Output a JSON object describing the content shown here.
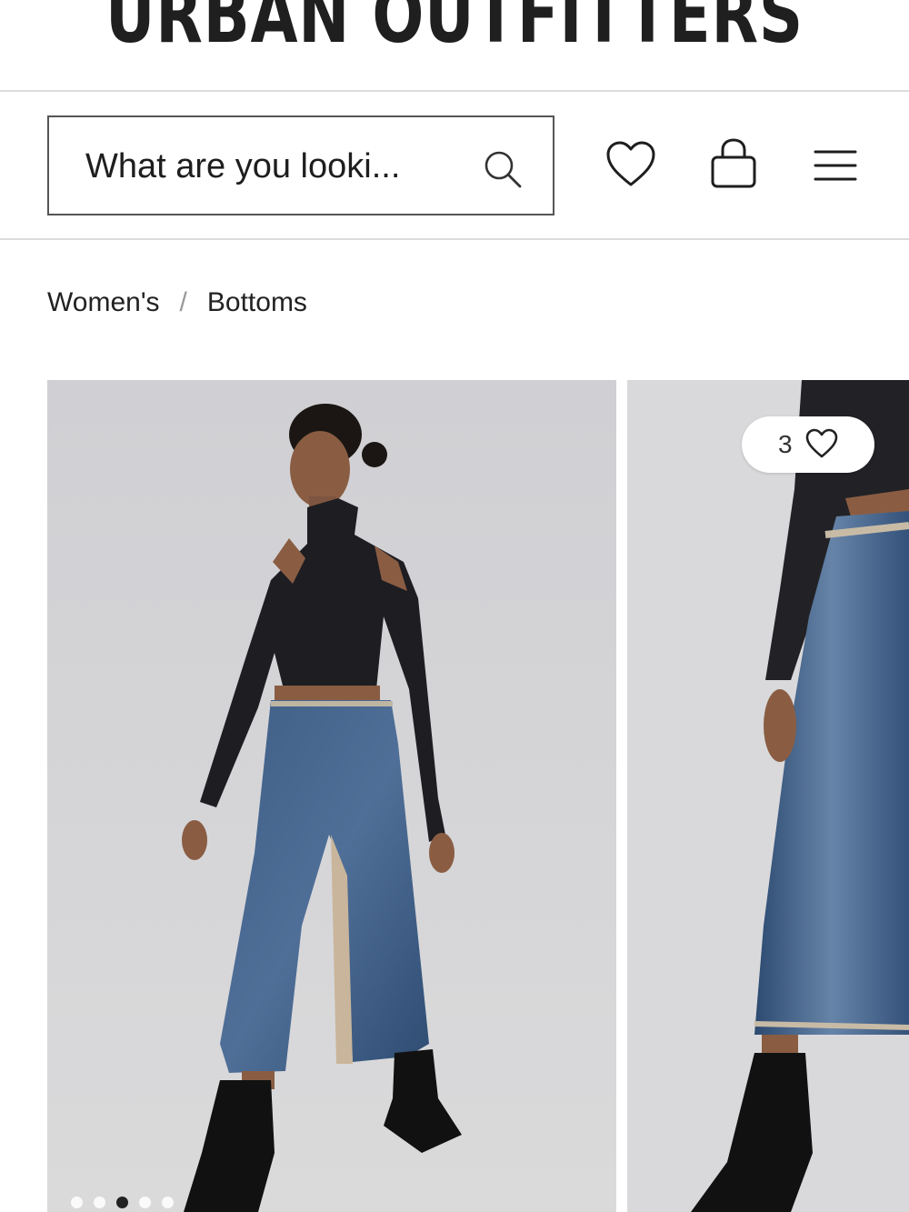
{
  "header": {
    "logo_text": "URBAN OUTFITTERS"
  },
  "search": {
    "placeholder": "What are you looking for?",
    "displayed_text": "What are you looki..."
  },
  "icons": {
    "search": "search-icon",
    "wishlist": "heart-icon",
    "bag": "shopping-bag-icon",
    "menu": "hamburger-menu-icon"
  },
  "breadcrumb": {
    "items": [
      "Women's",
      "Bottoms"
    ],
    "separator": "/"
  },
  "gallery": {
    "favorites_count": "3",
    "dots_total": 5,
    "dots_active_index": 2
  },
  "colors": {
    "text": "#222222",
    "divider": "#dcdcdc",
    "image_bg": "#d6d6d8"
  }
}
